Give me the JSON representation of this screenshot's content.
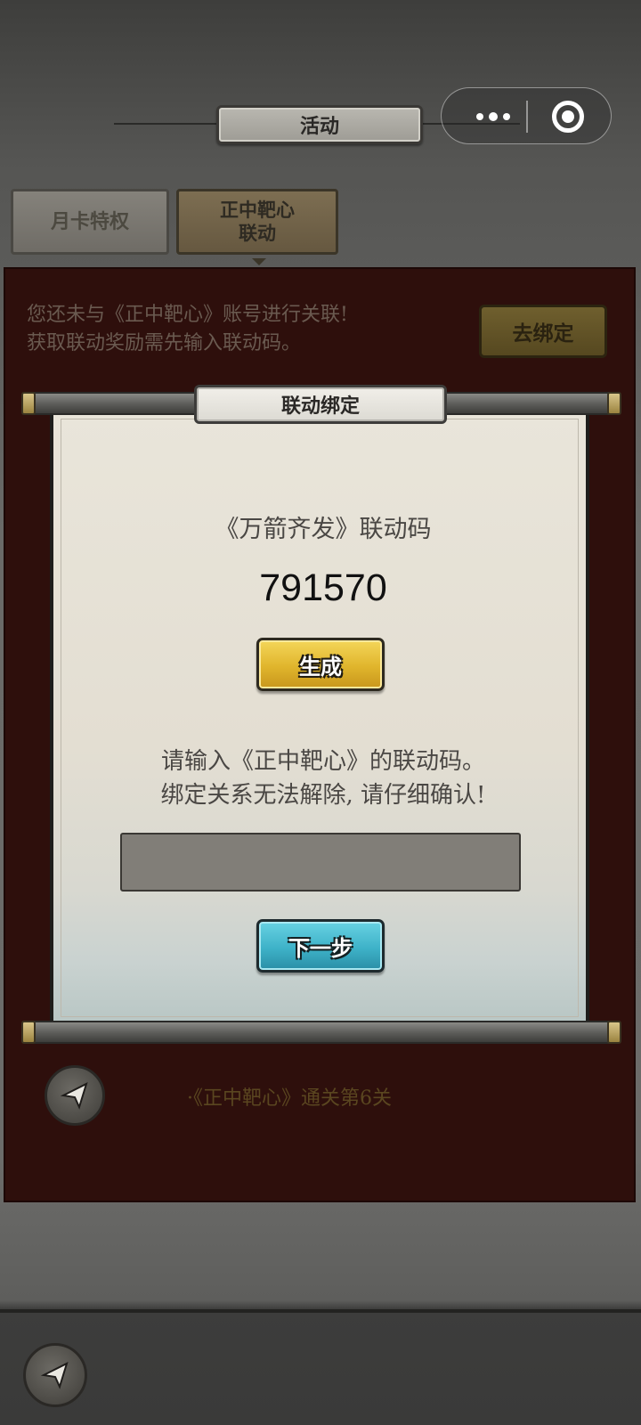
{
  "header": {
    "title": "活动"
  },
  "capsule": {
    "more_icon": "more-dots-icon",
    "close_icon": "target-circle-icon"
  },
  "tabs": [
    {
      "label": "月卡特权"
    },
    {
      "label": "正中靶心\n联动"
    }
  ],
  "notice": {
    "text": "您还未与《正中靶心》账号进行关联!\n获取联动奖励需先输入联动码。",
    "bind_button": "去绑定"
  },
  "reward_requirement": "·《正中靶心》通关第6关",
  "modal": {
    "title": "联动绑定",
    "code_label": "《万箭齐发》联动码",
    "code_value": "791570",
    "generate_button": "生成",
    "hint": "请输入《正中靶心》的联动码。\n绑定关系无法解除, 请仔细确认!",
    "input_value": "",
    "next_button": "下一步"
  },
  "colors": {
    "panel": "#2e0f0c",
    "generate_button": "#e0b52c",
    "next_button": "#3eb2c8",
    "input": "#817e78"
  }
}
